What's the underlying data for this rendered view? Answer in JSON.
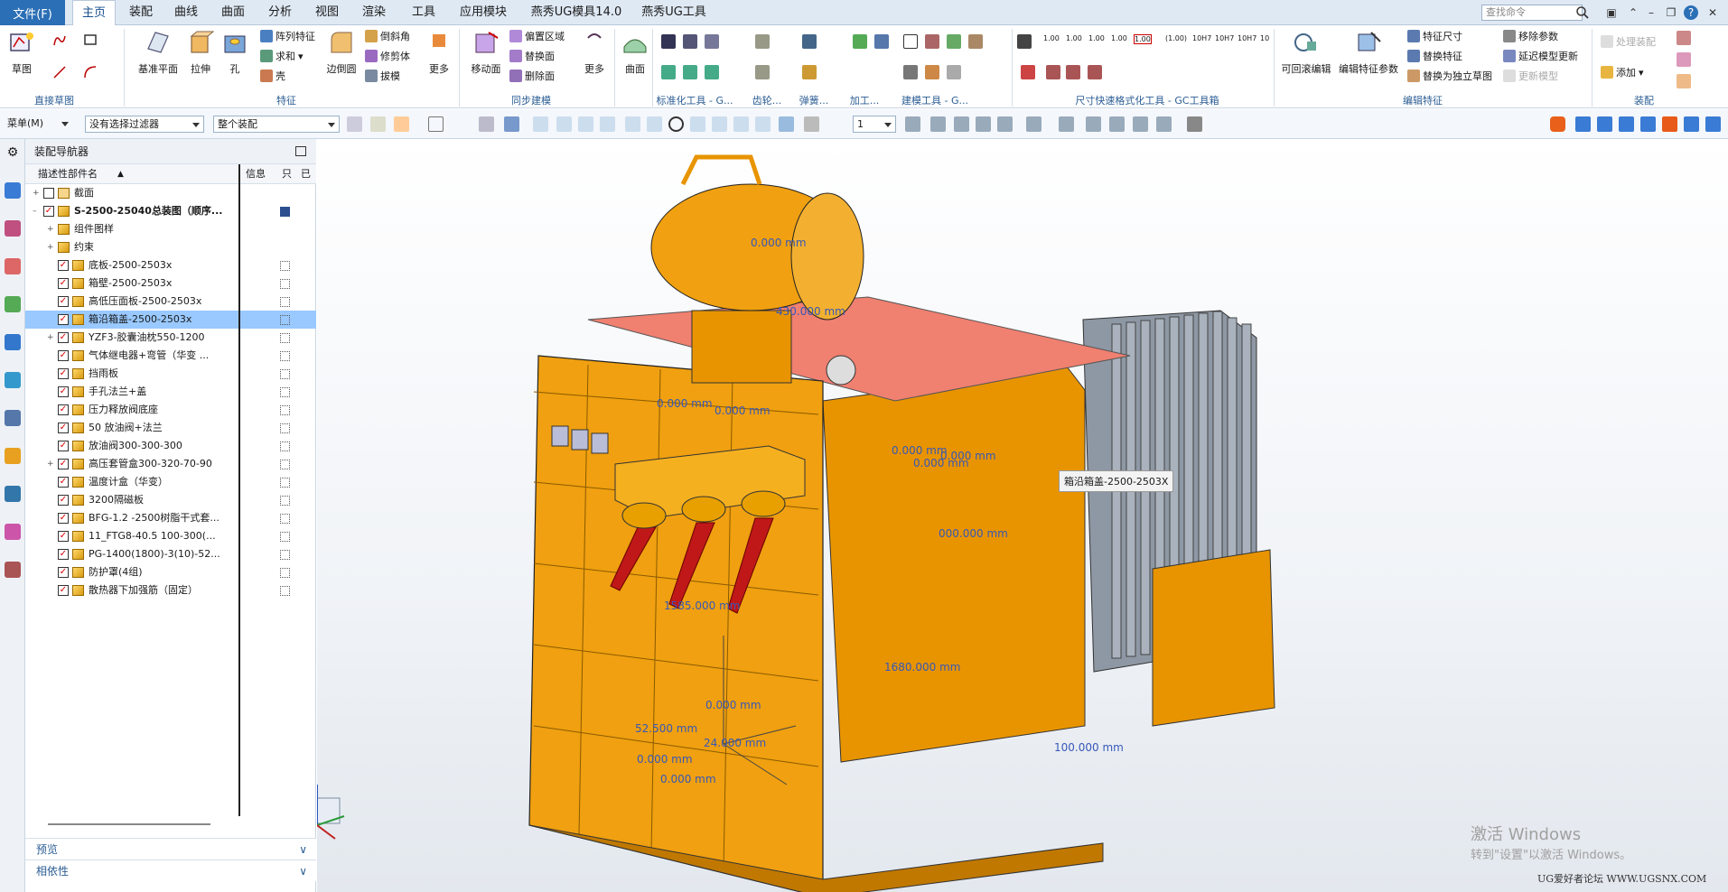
{
  "menubar": {
    "file": "文件(F)",
    "tabs": [
      "主页",
      "装配",
      "曲线",
      "曲面",
      "分析",
      "视图",
      "渲染",
      "工具",
      "应用模块",
      "燕秀UG模具14.0",
      "燕秀UG工具"
    ],
    "active_tab": "主页",
    "search_placeholder": "查找命令"
  },
  "ribbon": {
    "sketch": "草图",
    "datum_plane": "基准平面",
    "extrude": "拉伸",
    "hole": "孔",
    "pattern": "阵列特征",
    "unite": "求和",
    "shell": "壳",
    "edge_blend": "边倒圆",
    "chamfer": "倒斜角",
    "trim_body": "修剪体",
    "draft": "拔模",
    "more1": "更多",
    "move_face": "移动面",
    "offset_region": "偏置区域",
    "replace_face": "替换面",
    "delete_face": "删除面",
    "more2": "更多",
    "surface": "曲面",
    "more3": "更多",
    "playback_edit": "可回滚编辑",
    "edit_feature_params": "编辑特征参数",
    "feature_dims": "特征尺寸",
    "replace_feature": "替换特征",
    "replace_with_independent_sketch": "替换为独立草图",
    "remove_params": "移除参数",
    "delay_model_update": "延迟模型更新",
    "update_model": "更新模型",
    "assembly_process": "处理装配",
    "add": "添加",
    "dim_values": [
      "1.00",
      "1.00",
      "1.00",
      "1.00",
      "1.00",
      "(1.00)",
      "10H7",
      "10H7",
      "10H7",
      "10"
    ],
    "groups": {
      "direct_sketch": "直接草图",
      "feature": "特征",
      "sync_modeling": "同步建模",
      "std_tools": "标准化工具 - G...",
      "gear": "齿轮...",
      "spring": "弹簧...",
      "machining": "加工...",
      "modeling_tools": "建模工具 - G...",
      "dim_format": "尺寸快速格式化工具 - GC工具箱",
      "edit_feature": "编辑特征",
      "assembly": "装配"
    }
  },
  "toolbar2": {
    "menu": "菜单(M)",
    "filter": "没有选择过滤器",
    "scope": "整个装配",
    "layer": "1"
  },
  "navigator": {
    "title": "装配导航器",
    "col_name": "描述性部件名",
    "col_info": "信息",
    "col_readonly": "只",
    "col_modified": "已",
    "rows": [
      {
        "label": "截面",
        "level": 0
      },
      {
        "label": "S-2500-25040总装图（顺序...",
        "level": 0,
        "bold": true
      },
      {
        "label": "组件图样",
        "level": 1
      },
      {
        "label": "约束",
        "level": 1
      },
      {
        "label": "底板-2500-2503x",
        "level": 1
      },
      {
        "label": "箱壁-2500-2503x",
        "level": 1
      },
      {
        "label": "高低压面板-2500-2503x",
        "level": 1
      },
      {
        "label": "箱沿箱盖-2500-2503x",
        "level": 1,
        "selected": true
      },
      {
        "label": "YZF3-胶囊油枕550-1200",
        "level": 1
      },
      {
        "label": "气体继电器+弯管（华变 ...",
        "level": 1
      },
      {
        "label": "挡雨板",
        "level": 1
      },
      {
        "label": "手孔法兰+盖",
        "level": 1
      },
      {
        "label": "压力释放阀底座",
        "level": 1
      },
      {
        "label": "50 放油阀+法兰",
        "level": 1
      },
      {
        "label": "放油阀300-300-300",
        "level": 1
      },
      {
        "label": "高压套管盒300-320-70-90",
        "level": 1
      },
      {
        "label": "温度计盒（华变）",
        "level": 1
      },
      {
        "label": "3200隔磁板",
        "level": 1
      },
      {
        "label": "BFG-1.2 -2500树脂干式套...",
        "level": 1
      },
      {
        "label": "11_FTG8-40.5  100-300(...",
        "level": 1
      },
      {
        "label": "PG-1400(1800)-3(10)-52...",
        "level": 1
      },
      {
        "label": "防护罩(4组)",
        "level": 1
      },
      {
        "label": "散热器下加强筋（固定）",
        "level": 1
      }
    ],
    "preview": "预览",
    "dependency": "相依性"
  },
  "viewport": {
    "tooltip": "箱沿箱盖-2500-2503X",
    "dims": [
      "0.000 mm",
      "430.000 mm",
      "0.000 mm",
      "0.000 mm",
      "0.000 mm",
      "0.000 mm",
      "1585.000 mm",
      "1680.000 mm",
      "0.000 mm",
      "52.500 mm",
      "24.000 mm",
      "0.000 mm",
      "0.000 mm",
      "100.000 mm",
      "000.000 mm",
      "0.000 mm"
    ],
    "watermark1": "激活 Windows",
    "watermark2": "转到\"设置\"以激活 Windows。",
    "forum": "UG爱好者论坛 WWW.UGSNX.COM"
  }
}
